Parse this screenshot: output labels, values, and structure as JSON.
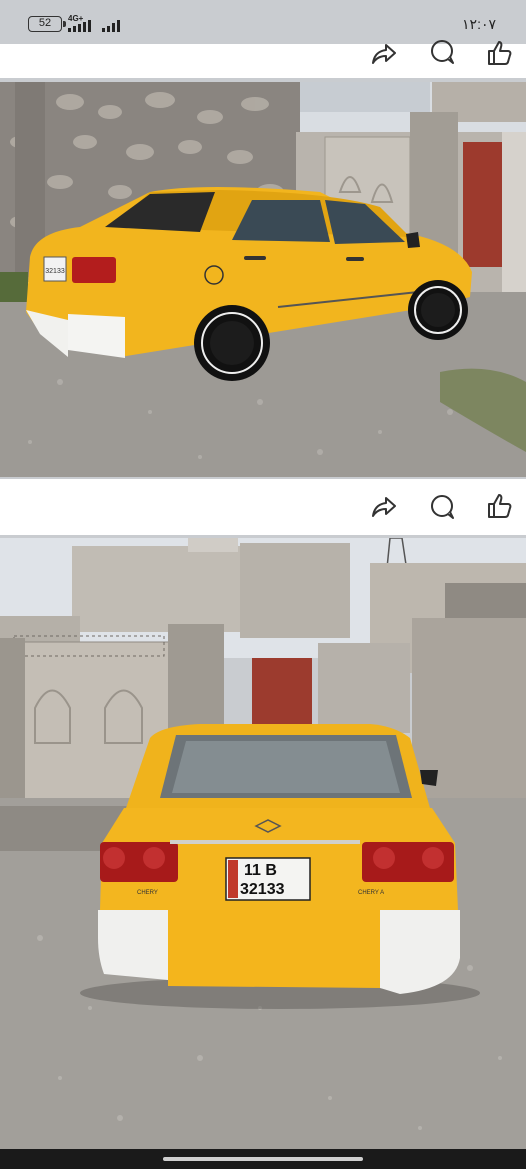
{
  "status_bar": {
    "battery": "52",
    "network": "4G+",
    "time": "١٢:٠٧"
  },
  "post_actions": {
    "icons": [
      "share-icon",
      "comment-icon",
      "like-icon"
    ]
  },
  "photo_top": {
    "plate_text": "32133"
  },
  "photo_bottom": {
    "plate_line1": "11 B",
    "plate_line2": "32133",
    "brand_left": "CHERY",
    "brand_right": "CHERY A"
  }
}
